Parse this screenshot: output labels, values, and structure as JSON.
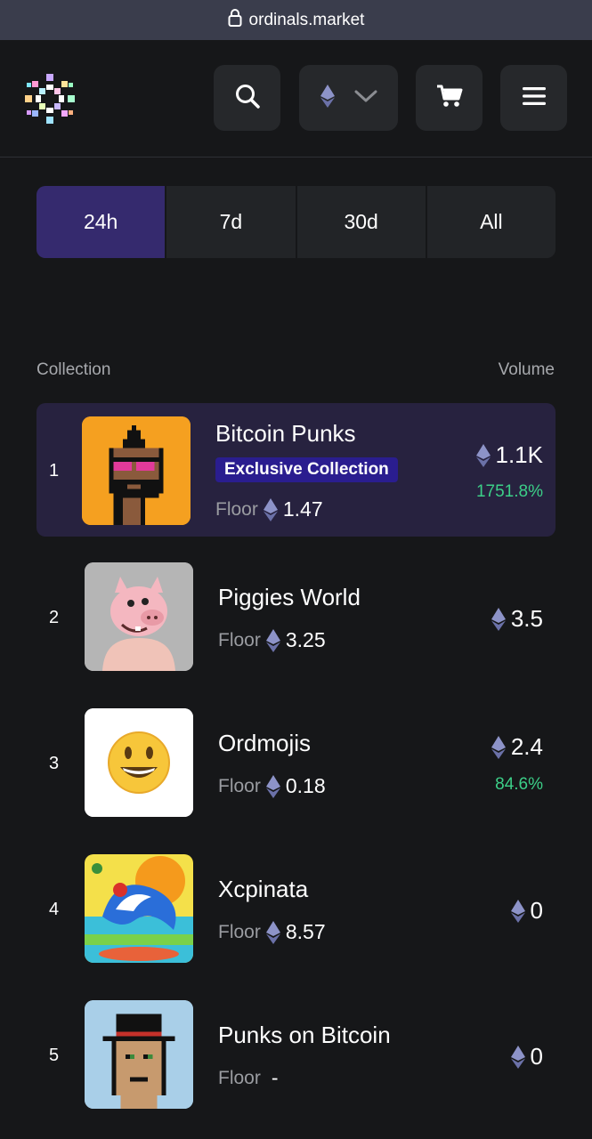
{
  "browser": {
    "url": "ordinals.market"
  },
  "header": {
    "logo": "ordinals-logo",
    "buttons": [
      "search-icon",
      "ethereum-network-selector",
      "cart-icon",
      "menu-icon"
    ]
  },
  "tabs": [
    {
      "label": "24h",
      "active": true
    },
    {
      "label": "7d",
      "active": false
    },
    {
      "label": "30d",
      "active": false
    },
    {
      "label": "All",
      "active": false
    }
  ],
  "table": {
    "col_collection": "Collection",
    "col_volume": "Volume",
    "floor_label": "Floor",
    "rows": [
      {
        "rank": "1",
        "name": "Bitcoin Punks",
        "badge": "Exclusive Collection",
        "floor": "1.47",
        "volume": "1.1K",
        "change": "1751.8%"
      },
      {
        "rank": "2",
        "name": "Piggies World",
        "floor": "3.25",
        "volume": "3.5"
      },
      {
        "rank": "3",
        "name": "Ordmojis",
        "floor": "0.18",
        "volume": "2.4",
        "change": "84.6%"
      },
      {
        "rank": "4",
        "name": "Xcpinata",
        "floor": "8.57",
        "volume": "0"
      },
      {
        "rank": "5",
        "name": "Punks on Bitcoin",
        "floor": "-",
        "volume": "0"
      }
    ]
  },
  "colors": {
    "background": "#161719",
    "active_tab": "#352a6e",
    "highlight_row": "#27223f",
    "badge": "#2a1d8f",
    "positive": "#3ccf88"
  }
}
